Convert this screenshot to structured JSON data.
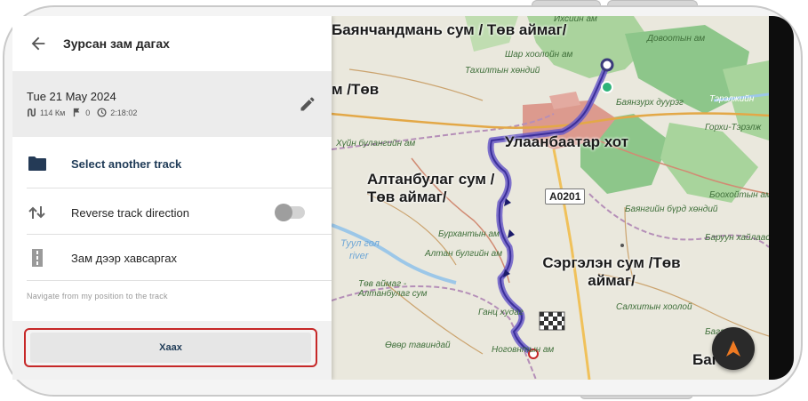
{
  "panel": {
    "title": "Зурсан зам дагах",
    "track": {
      "date": "Tue 21 May 2024",
      "distance": "114 Км",
      "waypoints": "0",
      "duration": "2:18:02"
    },
    "options": [
      {
        "label": "Select another track",
        "icon": "folder-icon"
      },
      {
        "label": "Reverse track direction",
        "icon": "swap-vertical-icon",
        "toggle": false
      },
      {
        "label": "Зам дээр хавсаргах",
        "icon": "road-icon"
      }
    ],
    "hint": "Navigate from my position to the track",
    "close_label": "Хаах"
  },
  "map": {
    "region_labels": [
      "Баянчандмань сум / Төв аймаг/",
      "м /Төв",
      "Улаанбаатар хот",
      "Алтанбулаг сум /Төв аймаг/",
      "Сэргэлэн сум /Төв аймаг/",
      "Баг"
    ],
    "road_badge": "A0201",
    "small_labels": [
      "Ихсийн ам",
      "Шар хоолойн ам",
      "Тахилтын хөндий",
      "Довоотын ам",
      "Баянзурх дуурэг",
      "Тэрэлжийн",
      "Горхи-Тэрэлж",
      "Хүйн булангийн ам",
      "Боохойтын ам",
      "Баянгийн бүрд хөндий",
      "Бурхантын ам",
      "Алтан булгийн ам",
      "Баруун хайлаас",
      "Төв аймаг - Алтанбулаг сум",
      "Салхитын хоолой",
      "Ганц худаг",
      "Өвөр тавиндай",
      "Ноговнтын ам",
      "Багахан",
      "Туул гол",
      "river"
    ],
    "colors": {
      "track": "#6b5cc8",
      "forest": "#8dc68a",
      "urban": "#dc9a8e",
      "water": "#9cc7e8",
      "highlight": "#c62828"
    }
  }
}
